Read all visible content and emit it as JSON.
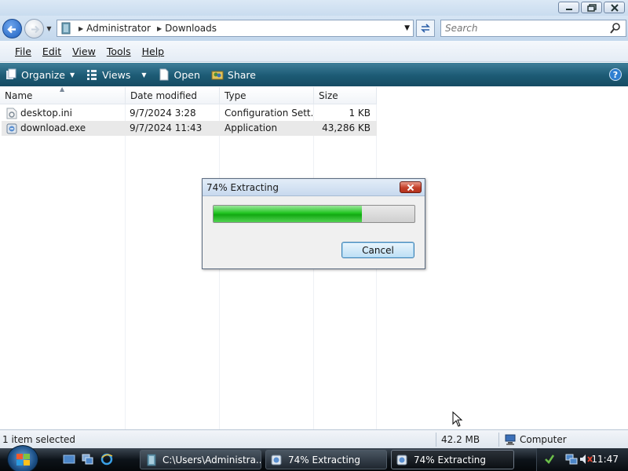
{
  "address": {
    "crumbs": [
      "Administrator",
      "Downloads"
    ]
  },
  "search": {
    "placeholder": "Search"
  },
  "menu": [
    "File",
    "Edit",
    "View",
    "Tools",
    "Help"
  ],
  "toolbar": {
    "organize": "Organize",
    "views": "Views",
    "open": "Open",
    "share": "Share",
    "help": "?"
  },
  "columns": {
    "name": "Name",
    "date": "Date modified",
    "type": "Type",
    "size": "Size"
  },
  "files": [
    {
      "name": "desktop.ini",
      "date": "9/7/2024 3:28",
      "type": "Configuration Sett...",
      "size": "1 KB",
      "selected": false
    },
    {
      "name": "download.exe",
      "date": "9/7/2024 11:43",
      "type": "Application",
      "size": "43,286 KB",
      "selected": true
    }
  ],
  "status": {
    "selection": "1 item selected",
    "size": "42.2 MB",
    "location": "Computer"
  },
  "dialog": {
    "title": "74% Extracting",
    "progress_percent": 74,
    "cancel": "Cancel"
  },
  "taskbar": {
    "tasks": [
      "C:\\Users\\Administra...",
      "74% Extracting",
      "74% Extracting"
    ],
    "clock": "11:47"
  },
  "colors": {
    "command_bar": "#1c5a74",
    "progress_green": "#21c521",
    "close_red": "#c4412b"
  }
}
